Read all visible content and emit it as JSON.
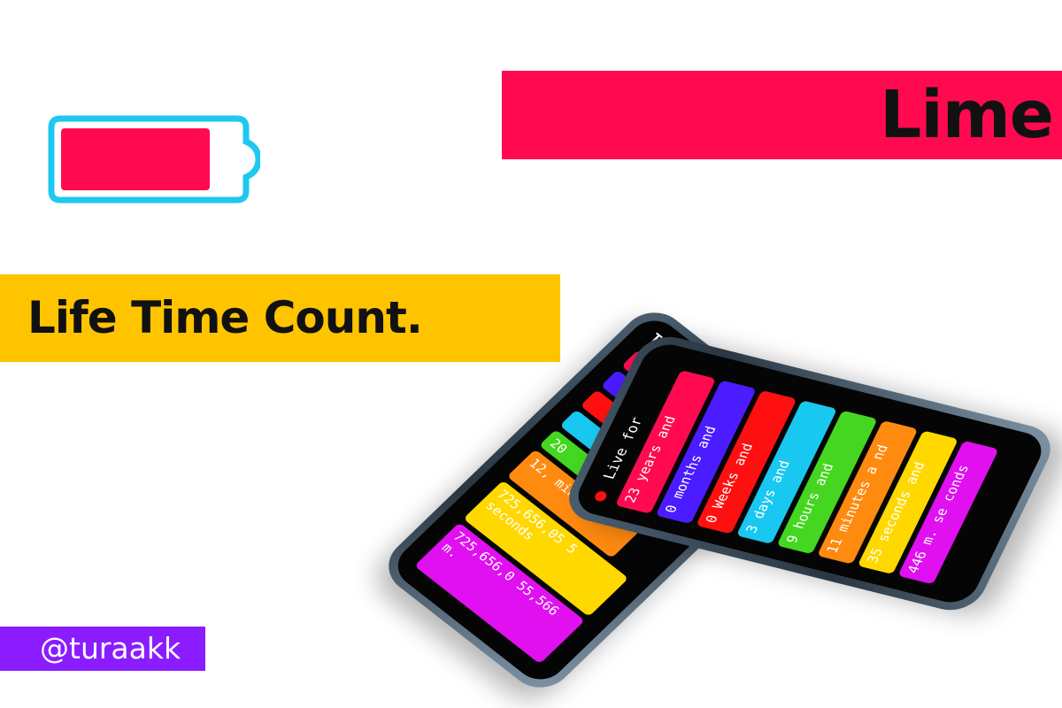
{
  "banners": {
    "lime": "Lime",
    "headline": "Life Time Count.",
    "handle": "@turaakk"
  },
  "colors": {
    "lime_banner": "#ff0a50",
    "headline_banner": "#ffc400",
    "handle_badge": "#8a1cff",
    "battery_outline": "#1ec8f0",
    "battery_fill": "#ff0a50"
  },
  "battery": {
    "icon": "battery-icon",
    "level": 0.75
  },
  "phone_front": {
    "header": "Live for",
    "bars": [
      {
        "text": "23 years and",
        "color": "#ff0a50"
      },
      {
        "text": "0 months and",
        "color": "#4a1cff"
      },
      {
        "text": "0 Weeks and",
        "color": "#ff1010"
      },
      {
        "text": "3 days and",
        "color": "#18c8f0"
      },
      {
        "text": "9 hours and",
        "color": "#44d620"
      },
      {
        "text": "11 minutes a nd",
        "color": "#ff8a10"
      },
      {
        "text": "35 seconds and",
        "color": "#ffd800"
      },
      {
        "text": "446 m. se conds",
        "color": "#e010f0"
      }
    ]
  },
  "phone_back": {
    "header": "Total",
    "bars": [
      {
        "text": "",
        "color": "#ff0a50"
      },
      {
        "text": "",
        "color": "#4a1cff"
      },
      {
        "text": "",
        "color": "#ff1010"
      },
      {
        "text": "",
        "color": "#18c8f0"
      },
      {
        "text": "20",
        "color": "#44d620"
      },
      {
        "text": "12, minutes",
        "color": "#ff8a10"
      },
      {
        "text": "725,656,05 5 seconds",
        "color": "#ffd800"
      },
      {
        "text": "725,656,0 55,566 m.",
        "color": "#e010f0"
      }
    ]
  }
}
